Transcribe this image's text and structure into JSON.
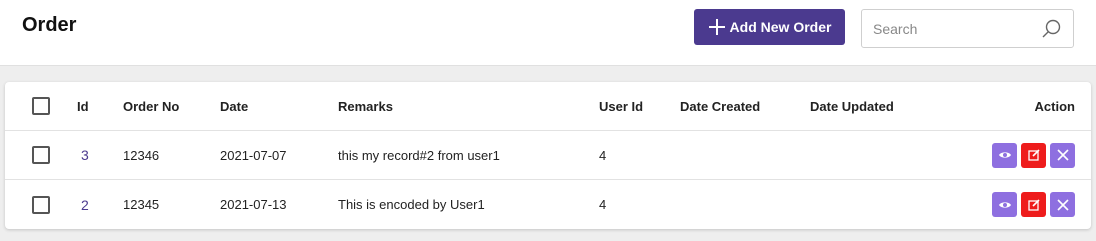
{
  "header": {
    "title": "Order",
    "add_button_label": "Add New Order",
    "search_placeholder": "Search"
  },
  "table": {
    "columns": {
      "id": "Id",
      "order_no": "Order No",
      "date": "Date",
      "remarks": "Remarks",
      "user_id": "User Id",
      "date_created": "Date Created",
      "date_updated": "Date Updated",
      "action": "Action"
    },
    "rows": [
      {
        "id": "3",
        "order_no": "12346",
        "date": "2021-07-07",
        "remarks": "this my record#2 from user1",
        "user_id": "4",
        "date_created": "",
        "date_updated": ""
      },
      {
        "id": "2",
        "order_no": "12345",
        "date": "2021-07-13",
        "remarks": "This is encoded by User1",
        "user_id": "4",
        "date_created": "",
        "date_updated": ""
      }
    ]
  },
  "icons": {
    "add": "plus-icon",
    "search": "search-icon",
    "view": "eye-icon",
    "edit": "edit-icon",
    "delete": "close-icon"
  },
  "colors": {
    "primary": "#4b3a8f",
    "view_button": "#8e6fe0",
    "edit_button": "#ee1c1c",
    "delete_button": "#8e6fe0"
  }
}
